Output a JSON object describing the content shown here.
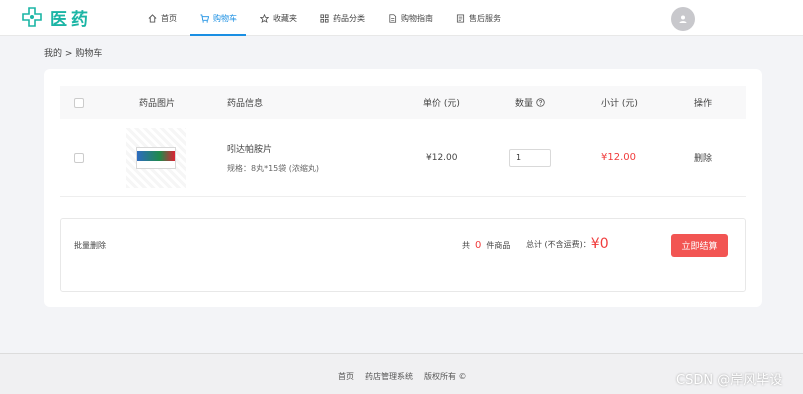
{
  "brand": {
    "name": "医药",
    "accent": "#1bb5a5"
  },
  "nav": {
    "items": [
      {
        "label": "首页",
        "icon": "home-icon"
      },
      {
        "label": "购物车",
        "icon": "cart-icon",
        "active": true
      },
      {
        "label": "收藏夹",
        "icon": "star-icon"
      },
      {
        "label": "药品分类",
        "icon": "grid-icon"
      },
      {
        "label": "购物指南",
        "icon": "document-icon"
      },
      {
        "label": "售后服务",
        "icon": "service-icon"
      }
    ],
    "active_color": "#1a8fe3"
  },
  "breadcrumb": {
    "home": "我的",
    "separator": ">",
    "current": "购物车"
  },
  "cart": {
    "headers": {
      "image": "药品图片",
      "info": "药品信息",
      "unit_price": "单价 (元)",
      "quantity": "数量",
      "subtotal": "小计 (元)",
      "action": "操作"
    },
    "items": [
      {
        "name": "吲达帕胺片",
        "spec": "规格：8丸*15袋 (浓缩丸)",
        "unit_price": "¥12.00",
        "quantity": "1",
        "subtotal": "¥12.00",
        "delete_label": "删除",
        "checked": false
      }
    ]
  },
  "summary": {
    "batch_delete": "批量删除",
    "count_prefix": "共",
    "count": "0",
    "count_suffix": "件商品",
    "total_label": "总计 (不含运费)：",
    "total": "¥0",
    "checkout_label": "立即结算",
    "price_color": "#f03c3c"
  },
  "footer": {
    "links": [
      "首页",
      "药店管理系统",
      "版权所有 ©"
    ]
  },
  "watermark": "CSDN @岸风毕设"
}
